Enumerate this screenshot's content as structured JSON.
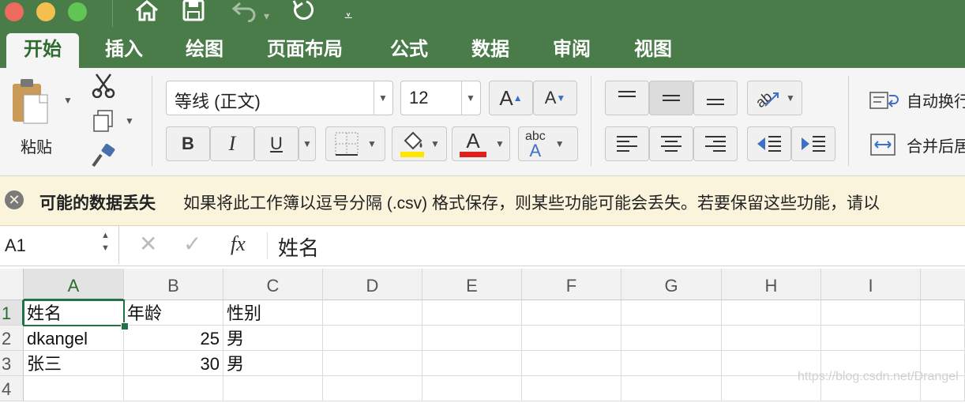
{
  "titlebar": {
    "traffic_colors": [
      "#ed6a5e",
      "#f4bf4f",
      "#61c554"
    ],
    "quick_access": [
      "home-icon",
      "save-icon",
      "undo-icon",
      "redo-icon",
      "customize-icon"
    ]
  },
  "tabs": [
    "开始",
    "插入",
    "绘图",
    "页面布局",
    "公式",
    "数据",
    "审阅",
    "视图"
  ],
  "ribbon": {
    "paste_label": "粘贴",
    "font_name": "等线 (正文)",
    "font_size": "12",
    "grow_font": "A",
    "shrink_font": "A",
    "bold": "B",
    "italic": "I",
    "underline": "U",
    "font_color_glyph": "A",
    "spell_top": "abc",
    "spell_bottom": "A",
    "wrap_text": "自动换行",
    "merge_center": "合并后居"
  },
  "infobar": {
    "title": "可能的数据丢失",
    "message": "如果将此工作簿以逗号分隔 (.csv) 格式保存，则某些功能可能会丢失。若要保留这些功能，请以"
  },
  "formula_bar": {
    "name_box": "A1",
    "fx": "fx",
    "content": "姓名"
  },
  "sheet": {
    "columns": [
      "A",
      "B",
      "C",
      "D",
      "E",
      "F",
      "G",
      "H",
      "I"
    ],
    "rows": [
      "1",
      "2",
      "3",
      "4"
    ],
    "cells": [
      [
        "姓名",
        "年龄",
        "性别"
      ],
      [
        "dkangel",
        "25",
        "男"
      ],
      [
        "张三",
        "30",
        "男"
      ]
    ],
    "selected_cell": "A1",
    "watermark": "https://blog.csdn.net/Drangel"
  },
  "colors": {
    "accent": "#4a7c4a",
    "selection": "#217346",
    "fill_highlight": "#ffe600",
    "font_color": "#e0201b",
    "info_error": "#7a7a7a"
  }
}
